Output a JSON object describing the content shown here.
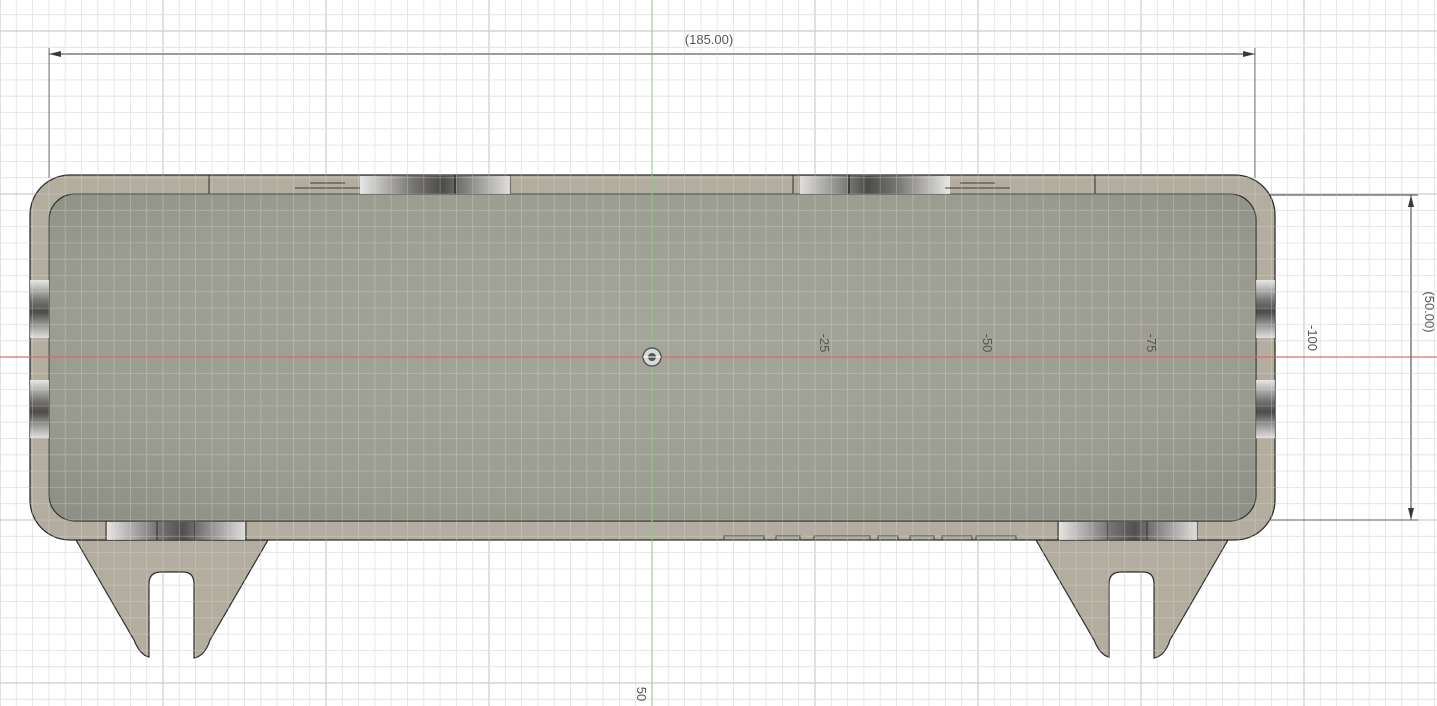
{
  "viewport": {
    "background": "#ffffff",
    "grid_minor_color": "#e3e3e3",
    "grid_major_color": "#cfcfcf",
    "x_axis_color": "#e05a5a",
    "y_axis_color": "#7ccf7c"
  },
  "dimensions": {
    "width_label": "(185.00)",
    "height_label": "(50.00)"
  },
  "axis_ticks": {
    "x_ticks": [
      "-25",
      "-50",
      "-75",
      "-100"
    ],
    "y_bottom_tick": "50"
  },
  "model": {
    "body_color": "#b3ad9f",
    "inner_color": "#9a9b8f",
    "edge_color": "#2d2d2d",
    "origin_icon": "origin-icon"
  }
}
